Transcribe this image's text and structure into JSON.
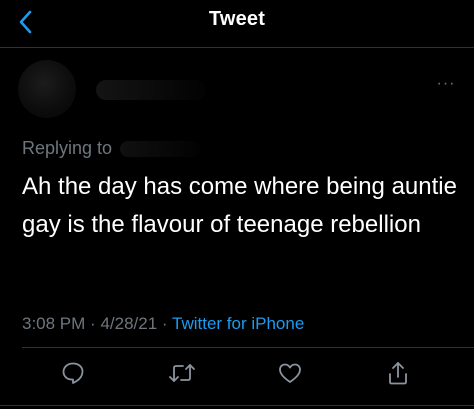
{
  "nav": {
    "title": "Tweet",
    "back_icon": "chevron-left-icon",
    "accent_color": "#1d9bf0"
  },
  "tweet": {
    "replying_label": "Replying to",
    "text": "Ah the day has come where being auntie gay is the flavour of teenage rebellion",
    "time": "3:08 PM",
    "date": "4/28/21",
    "separator": "·",
    "source": "Twitter for iPhone",
    "more_icon": "more-horizontal-icon",
    "more_label": "···"
  },
  "actions": [
    {
      "icon": "reply-icon"
    },
    {
      "icon": "retweet-icon"
    },
    {
      "icon": "like-icon"
    },
    {
      "icon": "share-icon"
    }
  ],
  "colors": {
    "background": "#000000",
    "text": "#ffffff",
    "secondary": "#6e767d",
    "link": "#1d9bf0",
    "divider": "#2f3336"
  }
}
